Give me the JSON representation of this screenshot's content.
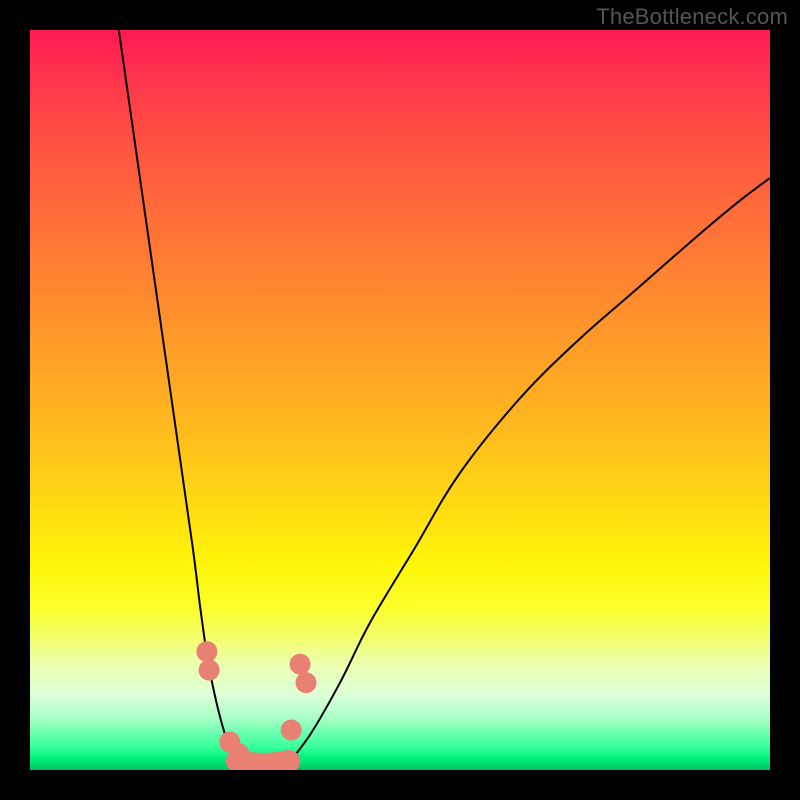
{
  "watermark": "TheBottleneck.com",
  "chart_data": {
    "type": "line",
    "title": "",
    "xlabel": "",
    "ylabel": "",
    "xlim": [
      0,
      100
    ],
    "ylim": [
      0,
      100
    ],
    "grid": false,
    "background": "rainbow-gradient-vertical",
    "series": [
      {
        "name": "curve-left",
        "x": [
          12,
          14,
          16,
          18,
          20,
          22,
          23,
          24,
          25,
          26,
          27,
          28
        ],
        "y": [
          100,
          86,
          72,
          58,
          44,
          30,
          22,
          15,
          10,
          6,
          3,
          1
        ]
      },
      {
        "name": "curve-right",
        "x": [
          35,
          38,
          42,
          46,
          52,
          58,
          66,
          74,
          82,
          90,
          96,
          100
        ],
        "y": [
          1,
          5,
          12,
          20,
          30,
          40,
          50,
          58,
          65,
          72,
          77,
          80
        ]
      }
    ],
    "markers": [
      {
        "name": "marker-left-upper-1",
        "x": 23.9,
        "y": 16.0,
        "r": 1.5,
        "color": "#e88074"
      },
      {
        "name": "marker-left-upper-2",
        "x": 24.2,
        "y": 13.5,
        "r": 1.5,
        "color": "#e88074"
      },
      {
        "name": "marker-left-lower-1",
        "x": 27.0,
        "y": 3.8,
        "r": 1.5,
        "color": "#e88074"
      },
      {
        "name": "marker-left-lower-2",
        "x": 28.2,
        "y": 2.2,
        "r": 1.5,
        "color": "#e88074"
      },
      {
        "name": "marker-right-upper-1",
        "x": 36.5,
        "y": 14.3,
        "r": 1.5,
        "color": "#e88074"
      },
      {
        "name": "marker-right-upper-2",
        "x": 37.3,
        "y": 11.8,
        "r": 1.5,
        "color": "#e88074"
      },
      {
        "name": "marker-right-lower-1",
        "x": 35.3,
        "y": 5.4,
        "r": 1.5,
        "color": "#e88074"
      }
    ],
    "bottom_segment": {
      "name": "valley-segment",
      "x0": 28.0,
      "y0": 1.2,
      "x1": 35.0,
      "y1": 1.2,
      "color": "#e88074",
      "width": 3.2
    },
    "colors": {
      "curve": "#000000",
      "markers": "#e88074",
      "frame": "#000000"
    }
  }
}
